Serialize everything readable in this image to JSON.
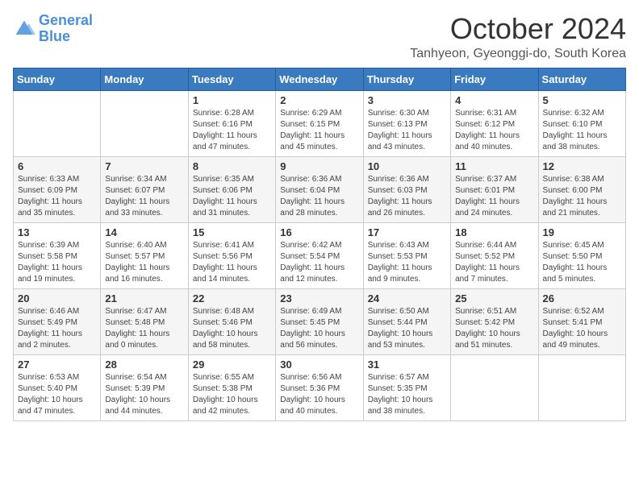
{
  "header": {
    "logo_general": "General",
    "logo_blue": "Blue",
    "month": "October 2024",
    "location": "Tanhyeon, Gyeonggi-do, South Korea"
  },
  "days_of_week": [
    "Sunday",
    "Monday",
    "Tuesday",
    "Wednesday",
    "Thursday",
    "Friday",
    "Saturday"
  ],
  "weeks": [
    [
      {
        "day": "",
        "info": ""
      },
      {
        "day": "",
        "info": ""
      },
      {
        "day": "1",
        "info": "Sunrise: 6:28 AM\nSunset: 6:16 PM\nDaylight: 11 hours and 47 minutes."
      },
      {
        "day": "2",
        "info": "Sunrise: 6:29 AM\nSunset: 6:15 PM\nDaylight: 11 hours and 45 minutes."
      },
      {
        "day": "3",
        "info": "Sunrise: 6:30 AM\nSunset: 6:13 PM\nDaylight: 11 hours and 43 minutes."
      },
      {
        "day": "4",
        "info": "Sunrise: 6:31 AM\nSunset: 6:12 PM\nDaylight: 11 hours and 40 minutes."
      },
      {
        "day": "5",
        "info": "Sunrise: 6:32 AM\nSunset: 6:10 PM\nDaylight: 11 hours and 38 minutes."
      }
    ],
    [
      {
        "day": "6",
        "info": "Sunrise: 6:33 AM\nSunset: 6:09 PM\nDaylight: 11 hours and 35 minutes."
      },
      {
        "day": "7",
        "info": "Sunrise: 6:34 AM\nSunset: 6:07 PM\nDaylight: 11 hours and 33 minutes."
      },
      {
        "day": "8",
        "info": "Sunrise: 6:35 AM\nSunset: 6:06 PM\nDaylight: 11 hours and 31 minutes."
      },
      {
        "day": "9",
        "info": "Sunrise: 6:36 AM\nSunset: 6:04 PM\nDaylight: 11 hours and 28 minutes."
      },
      {
        "day": "10",
        "info": "Sunrise: 6:36 AM\nSunset: 6:03 PM\nDaylight: 11 hours and 26 minutes."
      },
      {
        "day": "11",
        "info": "Sunrise: 6:37 AM\nSunset: 6:01 PM\nDaylight: 11 hours and 24 minutes."
      },
      {
        "day": "12",
        "info": "Sunrise: 6:38 AM\nSunset: 6:00 PM\nDaylight: 11 hours and 21 minutes."
      }
    ],
    [
      {
        "day": "13",
        "info": "Sunrise: 6:39 AM\nSunset: 5:58 PM\nDaylight: 11 hours and 19 minutes."
      },
      {
        "day": "14",
        "info": "Sunrise: 6:40 AM\nSunset: 5:57 PM\nDaylight: 11 hours and 16 minutes."
      },
      {
        "day": "15",
        "info": "Sunrise: 6:41 AM\nSunset: 5:56 PM\nDaylight: 11 hours and 14 minutes."
      },
      {
        "day": "16",
        "info": "Sunrise: 6:42 AM\nSunset: 5:54 PM\nDaylight: 11 hours and 12 minutes."
      },
      {
        "day": "17",
        "info": "Sunrise: 6:43 AM\nSunset: 5:53 PM\nDaylight: 11 hours and 9 minutes."
      },
      {
        "day": "18",
        "info": "Sunrise: 6:44 AM\nSunset: 5:52 PM\nDaylight: 11 hours and 7 minutes."
      },
      {
        "day": "19",
        "info": "Sunrise: 6:45 AM\nSunset: 5:50 PM\nDaylight: 11 hours and 5 minutes."
      }
    ],
    [
      {
        "day": "20",
        "info": "Sunrise: 6:46 AM\nSunset: 5:49 PM\nDaylight: 11 hours and 2 minutes."
      },
      {
        "day": "21",
        "info": "Sunrise: 6:47 AM\nSunset: 5:48 PM\nDaylight: 11 hours and 0 minutes."
      },
      {
        "day": "22",
        "info": "Sunrise: 6:48 AM\nSunset: 5:46 PM\nDaylight: 10 hours and 58 minutes."
      },
      {
        "day": "23",
        "info": "Sunrise: 6:49 AM\nSunset: 5:45 PM\nDaylight: 10 hours and 56 minutes."
      },
      {
        "day": "24",
        "info": "Sunrise: 6:50 AM\nSunset: 5:44 PM\nDaylight: 10 hours and 53 minutes."
      },
      {
        "day": "25",
        "info": "Sunrise: 6:51 AM\nSunset: 5:42 PM\nDaylight: 10 hours and 51 minutes."
      },
      {
        "day": "26",
        "info": "Sunrise: 6:52 AM\nSunset: 5:41 PM\nDaylight: 10 hours and 49 minutes."
      }
    ],
    [
      {
        "day": "27",
        "info": "Sunrise: 6:53 AM\nSunset: 5:40 PM\nDaylight: 10 hours and 47 minutes."
      },
      {
        "day": "28",
        "info": "Sunrise: 6:54 AM\nSunset: 5:39 PM\nDaylight: 10 hours and 44 minutes."
      },
      {
        "day": "29",
        "info": "Sunrise: 6:55 AM\nSunset: 5:38 PM\nDaylight: 10 hours and 42 minutes."
      },
      {
        "day": "30",
        "info": "Sunrise: 6:56 AM\nSunset: 5:36 PM\nDaylight: 10 hours and 40 minutes."
      },
      {
        "day": "31",
        "info": "Sunrise: 6:57 AM\nSunset: 5:35 PM\nDaylight: 10 hours and 38 minutes."
      },
      {
        "day": "",
        "info": ""
      },
      {
        "day": "",
        "info": ""
      }
    ]
  ]
}
